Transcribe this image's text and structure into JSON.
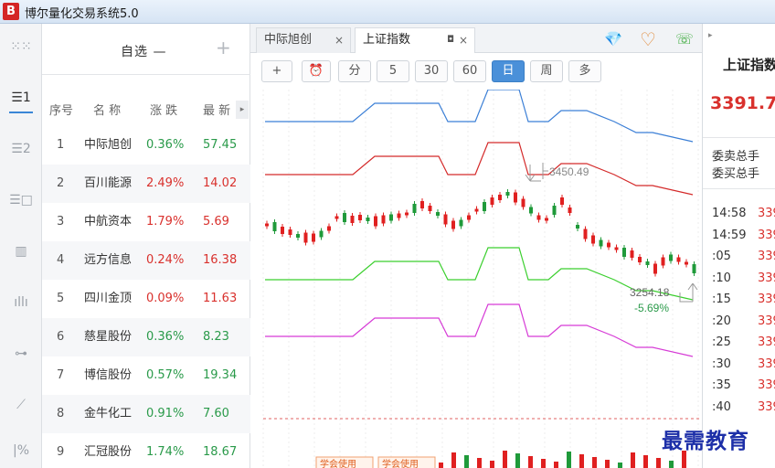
{
  "app": {
    "logo_letter": "B",
    "title": "博尔量化交易系统5.0"
  },
  "rail": {
    "icons": [
      "grid-icon",
      "list-one-icon",
      "list-two-icon",
      "list-box-icon",
      "bar-chart-icon",
      "volume-bars-icon",
      "slider-icon",
      "trend-chart-icon",
      "percent-icon"
    ],
    "glyphs": [
      "⁙⁙",
      "☰1",
      "☰2",
      "☰□",
      "▥",
      "ıllı",
      "⊶",
      "⟋",
      "|%"
    ]
  },
  "watchlist": {
    "title": "自选 —",
    "add_label": "+",
    "columns": {
      "no": "序号",
      "name": "名 称",
      "change": "涨 跌",
      "price": "最 新"
    },
    "scroll_arrow": "▸",
    "rows": [
      {
        "no": "1",
        "name": "中际旭创",
        "change": "0.36%",
        "price": "57.45",
        "color": "green"
      },
      {
        "no": "2",
        "name": "百川能源",
        "change": "2.49%",
        "price": "14.02",
        "color": "red"
      },
      {
        "no": "3",
        "name": "中航资本",
        "change": "1.79%",
        "price": "5.69",
        "color": "red"
      },
      {
        "no": "4",
        "name": "远方信息",
        "change": "0.24%",
        "price": "16.38",
        "color": "red"
      },
      {
        "no": "5",
        "name": "四川金顶",
        "change": "0.09%",
        "price": "11.63",
        "color": "red"
      },
      {
        "no": "6",
        "name": "慈星股份",
        "change": "0.36%",
        "price": "8.23",
        "color": "green"
      },
      {
        "no": "7",
        "name": "博信股份",
        "change": "0.57%",
        "price": "19.34",
        "color": "green"
      },
      {
        "no": "8",
        "name": "金牛化工",
        "change": "0.91%",
        "price": "7.60",
        "color": "green"
      },
      {
        "no": "9",
        "name": "汇冠股份",
        "change": "1.74%",
        "price": "18.67",
        "color": "green"
      }
    ]
  },
  "tabs": [
    {
      "label": "中际旭创",
      "pin": "",
      "close": "×"
    },
    {
      "label": "上证指数",
      "pin": "◘",
      "close": "×"
    }
  ],
  "top_icons": {
    "diamond": "💎",
    "heart": "♡",
    "chat": "☏"
  },
  "toolbar": {
    "buttons": [
      {
        "label": "+",
        "name": "crosshair-button",
        "active": false
      },
      {
        "label": "⏰",
        "name": "alarm-button",
        "active": false
      },
      {
        "label": "分",
        "name": "period-minute-button",
        "active": false
      },
      {
        "label": "5",
        "name": "period-5-button",
        "active": false
      },
      {
        "label": "30",
        "name": "period-30-button",
        "active": false
      },
      {
        "label": "60",
        "name": "period-60-button",
        "active": false
      },
      {
        "label": "日",
        "name": "period-day-button",
        "active": true
      },
      {
        "label": "周",
        "name": "period-week-button",
        "active": false
      },
      {
        "label": "多",
        "name": "period-multi-button",
        "active": false
      }
    ]
  },
  "chart_data": {
    "type": "line",
    "annotations": {
      "high": "3450.49",
      "low": "3254.18",
      "low_change": "-5.69%"
    },
    "volume_labels": [
      "学会使用",
      "学会使用"
    ],
    "colors": {
      "blue": "#3b7fd6",
      "red": "#d42a2a",
      "green": "#3bcf2e",
      "magenta": "#d63bd6",
      "up": "#e02020",
      "down": "#1f9a3a"
    }
  },
  "quote": {
    "arrow": "▸",
    "name": "上证指数",
    "price": "3391.7",
    "sell_total": "委卖总手",
    "buy_total": "委买总手",
    "ticks": [
      {
        "time": "14:58",
        "price": "339"
      },
      {
        "time": "14:59",
        "price": "339"
      },
      {
        "time": ":05",
        "price": "339"
      },
      {
        "time": ":10",
        "price": "339"
      },
      {
        "time": ":15",
        "price": "339"
      },
      {
        "time": ":20",
        "price": "339"
      },
      {
        "time": ":25",
        "price": "339"
      },
      {
        "time": ":30",
        "price": "339"
      },
      {
        "time": ":35",
        "price": "339"
      },
      {
        "time": ":40",
        "price": "339"
      }
    ]
  },
  "watermark": "最需教育"
}
